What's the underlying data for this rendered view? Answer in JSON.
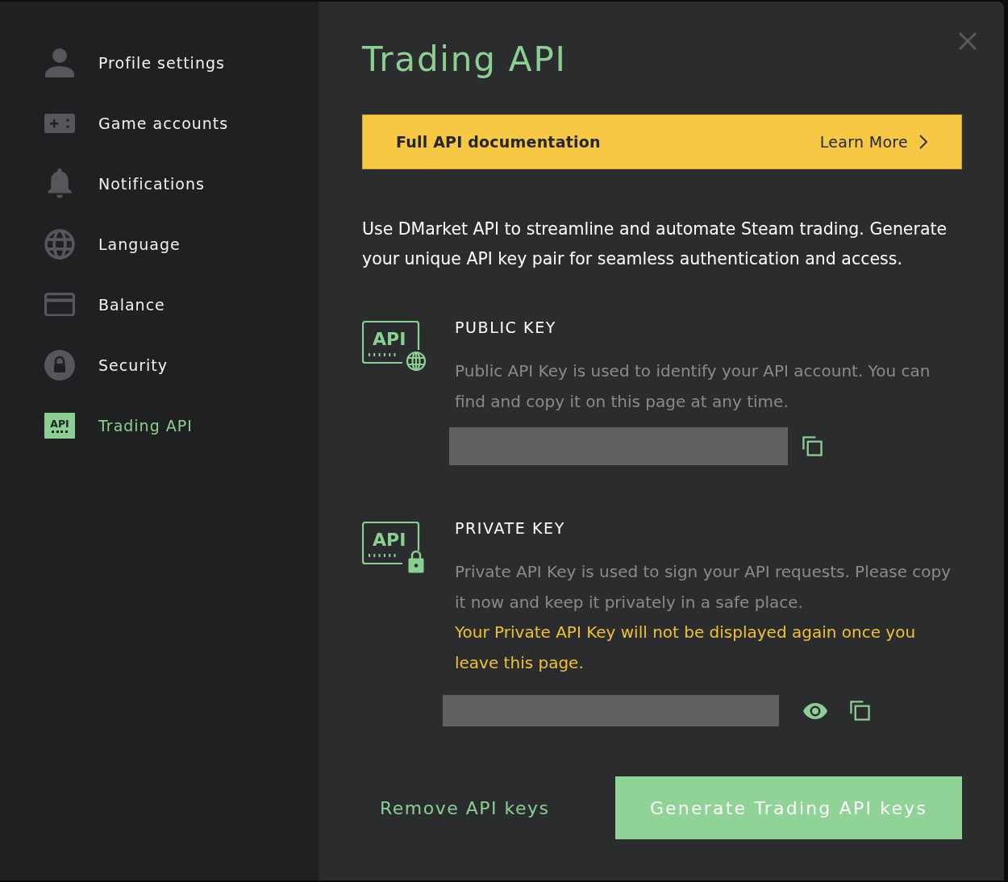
{
  "sidebar": {
    "items": [
      {
        "label": "Profile settings",
        "selected": false
      },
      {
        "label": "Game accounts",
        "selected": false
      },
      {
        "label": "Notifications",
        "selected": false
      },
      {
        "label": "Language",
        "selected": false
      },
      {
        "label": "Balance",
        "selected": false
      },
      {
        "label": "Security",
        "selected": false
      },
      {
        "label": "Trading API",
        "selected": true,
        "icon_text": "API"
      }
    ]
  },
  "title": "Trading API",
  "banner": {
    "text": "Full API documentation",
    "link": "Learn More"
  },
  "intro": "Use DMarket API to streamline and automate Steam trading. Generate your unique API key pair for seamless authentication and access.",
  "public_key": {
    "icon_text": "API",
    "heading": "PUBLIC KEY",
    "description": "Public API Key is used to identify your API account. You can find and copy it on this page at any time."
  },
  "private_key": {
    "icon_text": "API",
    "heading": "PRIVATE KEY",
    "description": "Private API Key is used to sign your API requests. Please copy it now and keep it privately in a safe place.",
    "warning": "Your Private API Key will not be displayed again once you leave this page."
  },
  "actions": {
    "remove": "Remove API keys",
    "generate": "Generate Trading API keys"
  }
}
